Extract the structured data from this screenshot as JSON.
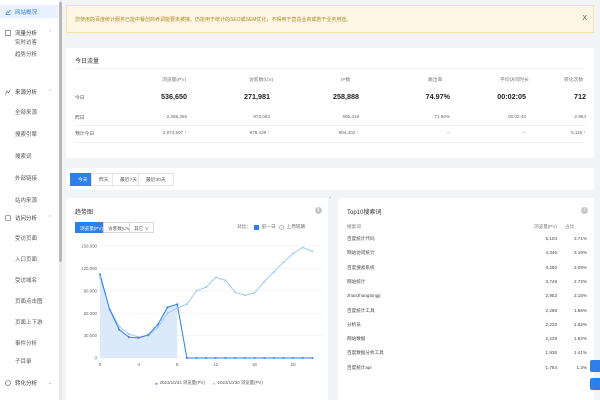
{
  "sidebar": {
    "active": "网站概况",
    "sections": [
      {
        "label": "流量分析",
        "items": [
          "实时访客",
          "趋势分析"
        ]
      },
      {
        "label": "来源分析",
        "items": [
          "全部来源",
          "搜索引擎",
          "搜索词",
          "外部链接",
          "站内来源"
        ]
      },
      {
        "label": "访问分析",
        "items": [
          "受访页面",
          "入口页面",
          "受访域名",
          "页面点击图",
          "页面上下游",
          "事件分析",
          "子目录"
        ]
      },
      {
        "label": "转化分析",
        "items": []
      }
    ]
  },
  "notice": {
    "text": "您使用的百度统计服务已能中餐创商养调能要未被接。仍能用于统计的SEO或SEM优化，不得用于营造业商或若干业务用途。",
    "close": "X"
  },
  "today": {
    "title": "今日流量",
    "headers": [
      "浏览量(PV)",
      "访客数(UV)",
      "IP数",
      "跳出率",
      "平均访问时长",
      "转化次数"
    ],
    "rows": [
      {
        "label": "今日",
        "values": [
          "536,650",
          "271,981",
          "258,888",
          "74.97%",
          "00:02:05",
          "712"
        ]
      },
      {
        "label": "昨日",
        "values": [
          "2,388,356",
          "973,063",
          "905,419",
          "71.96%",
          "00:02:43",
          "2,864"
        ]
      },
      {
        "label": "预计今日",
        "values": [
          "2,874,507",
          "978,439",
          "904,402",
          "--",
          "--",
          "5,115"
        ]
      }
    ],
    "up_icon": "arrow-up-icon",
    "expand": "⌄"
  },
  "tabs": [
    "今天",
    "昨天",
    "最近7天",
    "最近30天"
  ],
  "trend": {
    "title": "趋势图",
    "metric_tabs": [
      "浏览量(PV)",
      "访客数(UV)",
      "其它 ∨"
    ],
    "compare_label": "对比：",
    "compare_opt1": "前一日",
    "compare_opt2": "上周同期",
    "legend1": "2023/10/31 浏览量(PV)",
    "legend2": "2023/10/30 浏览量(PV)"
  },
  "chart_data": {
    "type": "line",
    "x": [
      0,
      1,
      2,
      3,
      4,
      5,
      6,
      7,
      8,
      9,
      10,
      11,
      12,
      13,
      14,
      15,
      16,
      17,
      18,
      19,
      20,
      21,
      22,
      23
    ],
    "series": [
      {
        "name": "2023/10/31 浏览量(PV)",
        "values": [
          112000,
          65000,
          38000,
          28000,
          27000,
          31000,
          45000,
          68000,
          72000,
          0,
          0,
          0,
          0,
          0,
          0,
          0,
          0,
          0,
          0,
          0,
          0,
          0,
          0,
          null
        ]
      },
      {
        "name": "2023/10/30 浏览量(PV)",
        "values": [
          108000,
          66000,
          42000,
          32000,
          28000,
          30000,
          41000,
          60000,
          67000,
          72000,
          90000,
          95000,
          108000,
          104000,
          88000,
          84000,
          87000,
          102000,
          115000,
          128000,
          140000,
          148000,
          143000,
          null
        ]
      }
    ],
    "yticks": [
      0,
      30000,
      60000,
      90000,
      120000,
      150000
    ],
    "yticklabels": [
      "0",
      "30,000",
      "60,000",
      "90,000",
      "120,000",
      "150,000"
    ],
    "xticks": [
      0,
      4,
      8,
      12,
      16,
      20
    ],
    "ylim": [
      0,
      150000
    ],
    "xlim": [
      0,
      23
    ],
    "colors": [
      "#2f7fe9",
      "#9ccbf3"
    ]
  },
  "top10": {
    "title": "Top10搜索词",
    "headers": [
      "搜索词",
      "浏览量(PV)",
      "占比"
    ],
    "rows": [
      {
        "term": "百度统计代码",
        "pv": "5,104",
        "ratio": "3.71%"
      },
      {
        "term": "网站访问统计",
        "pv": "4,346",
        "ratio": "3.16%"
      },
      {
        "term": "百度搜索系统",
        "pv": "4,250",
        "ratio": "3.09%"
      },
      {
        "term": "网站统计",
        "pv": "3,748",
        "ratio": "2.72%"
      },
      {
        "term": "zhanzhangtongji",
        "pv": "2,953",
        "ratio": "2.15%"
      },
      {
        "term": "百度统计工具",
        "pv": "2,288",
        "ratio": "1.66%"
      },
      {
        "term": "分析员",
        "pv": "2,233",
        "ratio": "1.62%"
      },
      {
        "term": "网站数据",
        "pv": "2,229",
        "ratio": "1.62%"
      },
      {
        "term": "百度数据分析工具",
        "pv": "1,936",
        "ratio": "1.41%"
      },
      {
        "term": "百度统计api",
        "pv": "1,784",
        "ratio": "1.3%"
      }
    ]
  }
}
